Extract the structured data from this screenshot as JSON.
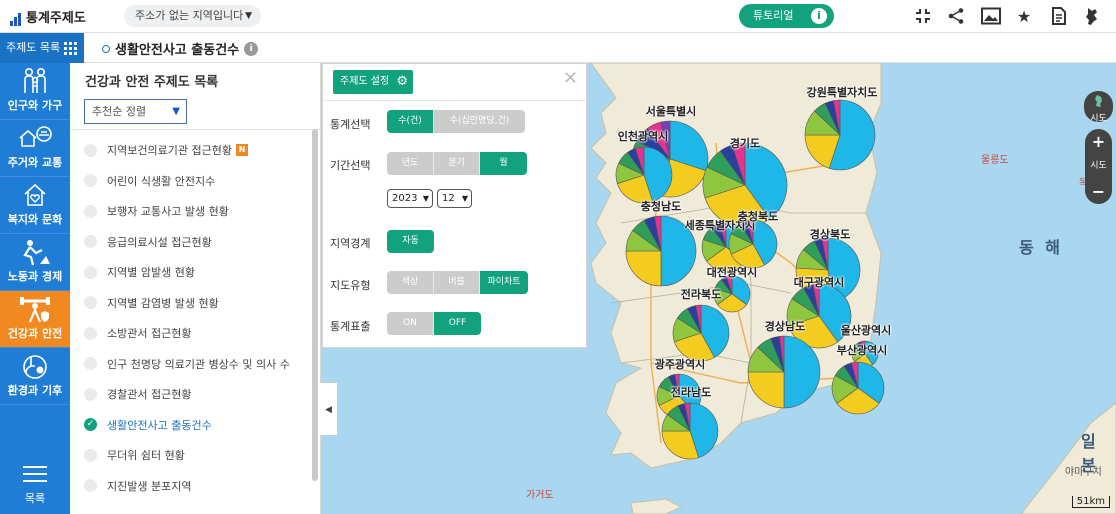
{
  "header": {
    "logo": "통계주제도",
    "region_select": "주소가 없는 지역입니다",
    "tutorial": "튜토리얼",
    "tools": [
      "fullscreen-exit-icon",
      "share-icon",
      "image-icon",
      "star-icon",
      "document-icon",
      "map-icon"
    ]
  },
  "subbar": {
    "menu_tab": "주제도 목록",
    "title": "생활안전사고 출동건수"
  },
  "categories": [
    {
      "label": "인구와 가구",
      "icon": "family-icon",
      "active": false
    },
    {
      "label": "주거와 교통",
      "icon": "house-car-icon",
      "active": false
    },
    {
      "label": "복지와 문화",
      "icon": "welfare-icon",
      "active": false
    },
    {
      "label": "노동과 경제",
      "icon": "worker-icon",
      "active": false
    },
    {
      "label": "건강과 안전",
      "icon": "health-safety-icon",
      "active": true
    },
    {
      "label": "환경과 기후",
      "icon": "environment-icon",
      "active": false
    }
  ],
  "category_menu": "목록",
  "list": {
    "title": "건강과 안전 주제도 목록",
    "sort": "추천순 정렬",
    "items": [
      {
        "label": "지역보건의료기관 접근현황",
        "badge": "N",
        "checked": false
      },
      {
        "label": "어린이 식생활 안전지수",
        "checked": false
      },
      {
        "label": "보행자 교통사고 발생 현황",
        "checked": false
      },
      {
        "label": "응급의료시설 접근현황",
        "checked": false
      },
      {
        "label": "지역별 암발생 현황",
        "checked": false
      },
      {
        "label": "지역별 감염병 발생 현황",
        "checked": false
      },
      {
        "label": "소방관서 접근현황",
        "checked": false
      },
      {
        "label": "인구 천명당 의료기관 병상수 및 의사 수",
        "checked": false
      },
      {
        "label": "경찰관서 접근현황",
        "checked": false
      },
      {
        "label": "생활안전사고 출동건수",
        "checked": true
      },
      {
        "label": "무더위 쉼터 현황",
        "checked": false
      },
      {
        "label": "지진발생 분포지역",
        "checked": false
      }
    ]
  },
  "settings": {
    "title": "주제도 설정",
    "rows": {
      "stat": {
        "label": "통계선택",
        "options": [
          "수(건)",
          "수(십만명당,건)"
        ],
        "selected": 0
      },
      "period": {
        "label": "기간선택",
        "options": [
          "년도",
          "분기",
          "월"
        ],
        "selected": 2,
        "year": "2023",
        "month": "12"
      },
      "boundary": {
        "label": "지역경계",
        "options": [
          "자동"
        ],
        "selected": 0
      },
      "maptype": {
        "label": "지도유형",
        "options": [
          "색상",
          "버블",
          "파이차트"
        ],
        "selected": 2
      },
      "display": {
        "label": "통계표출",
        "options": [
          "ON",
          "OFF"
        ],
        "selected": 1
      }
    }
  },
  "map": {
    "sea_labels": [
      "동 해",
      "일 본"
    ],
    "place_labels": [
      "울릉도",
      "독도",
      "가거도",
      "야마구치",
      "강원특별자치도"
    ],
    "scale": "51km",
    "controls": {
      "sido": "시도",
      "zoom_level": "시도"
    },
    "regions": [
      {
        "name": "서울특별시"
      },
      {
        "name": "인천광역시"
      },
      {
        "name": "경기도"
      },
      {
        "name": "강원특별자치도"
      },
      {
        "name": "충청남도"
      },
      {
        "name": "세종특별자치시"
      },
      {
        "name": "충청북도"
      },
      {
        "name": "대전광역시"
      },
      {
        "name": "경상북도"
      },
      {
        "name": "대구광역시"
      },
      {
        "name": "전라북도"
      },
      {
        "name": "경상남도"
      },
      {
        "name": "울산광역시"
      },
      {
        "name": "부산광역시"
      },
      {
        "name": "광주광역시"
      },
      {
        "name": "전라남도"
      }
    ],
    "pie_colors": [
      "#1fb6e8",
      "#f4cc1f",
      "#8ec63f",
      "#2e9e5a",
      "#2a3f9e",
      "#e6338f",
      "#7a3fb8",
      "#4fc1ae"
    ]
  }
}
